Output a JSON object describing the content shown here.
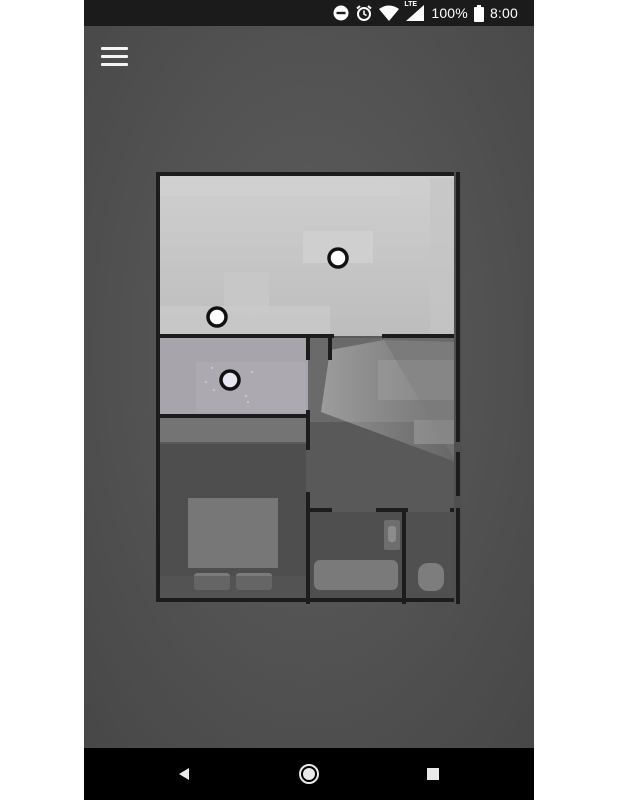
{
  "status_bar": {
    "battery_percent": "100%",
    "time": "8:00",
    "network_label": "LTE",
    "icons": [
      "do-not-disturb-icon",
      "alarm-icon",
      "wifi-icon",
      "cell-signal-icon",
      "battery-icon"
    ]
  },
  "toolbar": {
    "menu_icon": "hamburger-menu-icon"
  },
  "floorplan": {
    "markers": [
      "camera-marker-living-room",
      "camera-marker-window",
      "camera-marker-hallway"
    ],
    "selected_marker": "camera-marker-hallway"
  },
  "nav_bar": {
    "icons": [
      "back-icon",
      "home-icon",
      "recents-icon"
    ]
  },
  "colors": {
    "background": "#545454",
    "status_bar": "#1b1b1b",
    "nav_bar": "#000000",
    "walls": "#1c1c1c",
    "marker_fill": "#ffffff",
    "marker_border": "#111111"
  }
}
